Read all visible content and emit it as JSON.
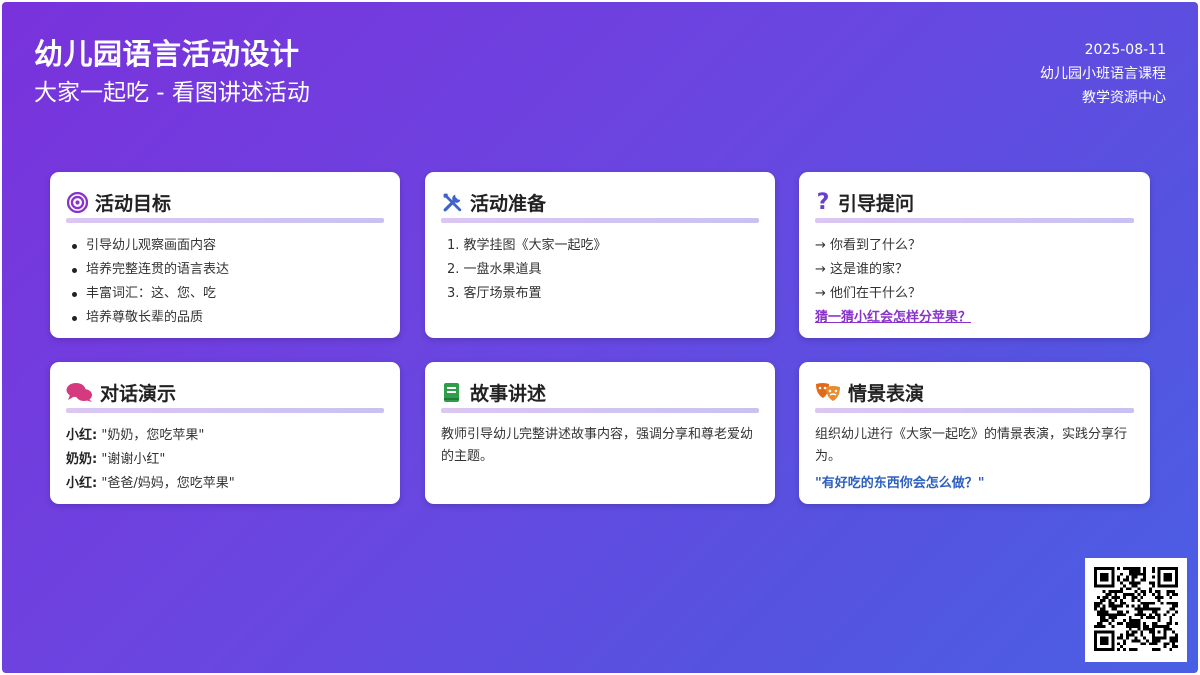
{
  "header": {
    "title": "幼儿园语言活动设计",
    "subtitle": "大家一起吃 - 看图讲述活动",
    "date": "2025-08-11",
    "course": "幼儿园小班语言课程",
    "center": "教学资源中心"
  },
  "cards": {
    "goals": {
      "title": "活动目标",
      "icon": "target-icon",
      "items": [
        "引导幼儿观察画面内容",
        "培养完整连贯的语言表达",
        "丰富词汇：这、您、吃",
        "培养尊敬长辈的品质"
      ]
    },
    "prep": {
      "title": "活动准备",
      "icon": "tools-icon",
      "items": [
        "1. 教学挂图《大家一起吃》",
        "2. 一盘水果道具",
        "3. 客厅场景布置"
      ]
    },
    "questions": {
      "title": "引导提问",
      "icon": "question-icon",
      "items": [
        "→ 你看到了什么？",
        "→ 这是谁的家？",
        "→ 他们在干什么？"
      ],
      "link": "猜一猜小红会怎样分苹果？"
    },
    "dialogue": {
      "title": "对话演示",
      "icon": "chat-icon",
      "lines": [
        {
          "speaker": "小红:",
          "text": " \"奶奶，您吃苹果\""
        },
        {
          "speaker": "奶奶:",
          "text": " \"谢谢小红\""
        },
        {
          "speaker": "小红:",
          "text": " \"爸爸/妈妈，您吃苹果\""
        }
      ]
    },
    "story": {
      "title": "故事讲述",
      "icon": "book-icon",
      "text": "教师引导幼儿完整讲述故事内容，强调分享和尊老爱幼的主题。"
    },
    "roleplay": {
      "title": "情景表演",
      "icon": "theater-masks-icon",
      "text": "组织幼儿进行《大家一起吃》的情景表演，实践分享行为。",
      "quote": "\"有好吃的东西你会怎么做？\""
    }
  },
  "colors": {
    "bg_start": "#7a32dc",
    "bg_end": "#4a60e4",
    "accent_purple": "#8a32cc",
    "accent_blue": "#2c5fbf"
  }
}
